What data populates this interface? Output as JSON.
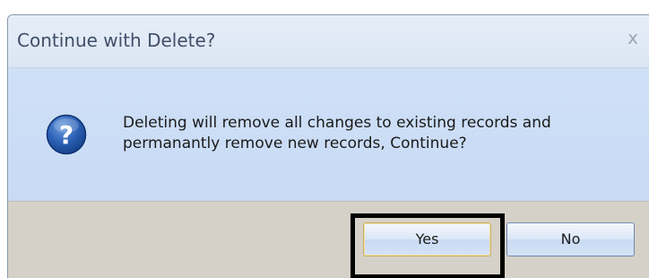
{
  "dialog": {
    "title": "Continue with Delete?",
    "close_glyph": "x",
    "icon": "question-icon",
    "message_line1": "Deleting will remove all changes to existing records and",
    "message_line2": "permanantly remove new records, Continue?",
    "buttons": {
      "yes_label": "Yes",
      "no_label": "No"
    }
  },
  "colors": {
    "content_bg": "#c8dbf5",
    "button_bar_bg": "#d6d1c8",
    "icon_blue": "#1f54a8",
    "highlight_box": "#000000"
  }
}
